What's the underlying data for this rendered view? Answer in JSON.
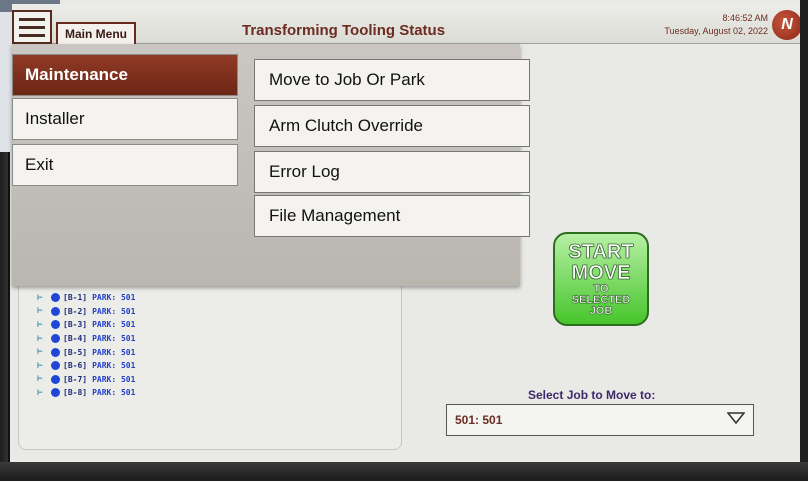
{
  "titlebar": {
    "menu_button": "Main Menu",
    "title": "Transforming Tooling Status",
    "time": "8:46:52 AM",
    "date": "Tuesday, August 02, 2022",
    "logo_glyph": "N"
  },
  "menu": {
    "primary": [
      {
        "label": "Maintenance",
        "active": true
      },
      {
        "label": "Installer",
        "active": false
      },
      {
        "label": "Exit",
        "active": false
      }
    ],
    "submenu": [
      {
        "label": "Move to Job Or Park"
      },
      {
        "label": "Arm Clutch Override"
      },
      {
        "label": "Error Log"
      },
      {
        "label": "File Management"
      }
    ]
  },
  "tooling_list": [
    {
      "id": "[B-1]",
      "status": "PARK: 501"
    },
    {
      "id": "[B-2]",
      "status": "PARK: 501"
    },
    {
      "id": "[B-3]",
      "status": "PARK: 501"
    },
    {
      "id": "[B-4]",
      "status": "PARK: 501"
    },
    {
      "id": "[B-5]",
      "status": "PARK: 501"
    },
    {
      "id": "[B-6]",
      "status": "PARK: 501"
    },
    {
      "id": "[B-7]",
      "status": "PARK: 501"
    },
    {
      "id": "[B-8]",
      "status": "PARK: 501"
    }
  ],
  "start_move": {
    "line1": "START",
    "line2": "MOVE",
    "line3": "TO",
    "line4": "SELECTED",
    "line5": "JOB"
  },
  "job_select": {
    "label": "Select Job to Move to:",
    "value": "501:  501"
  },
  "colors": {
    "accent": "#6d2614",
    "list_text": "#2340c8",
    "start_green": "#47c52c"
  }
}
